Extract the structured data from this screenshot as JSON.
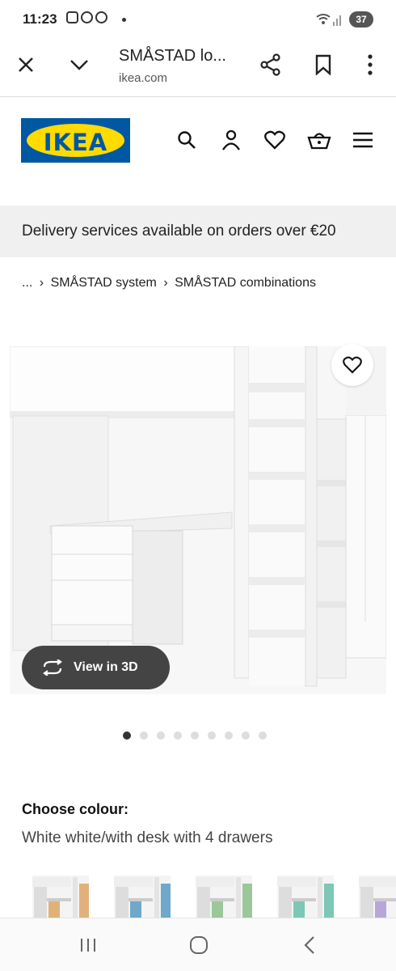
{
  "status_bar": {
    "time": "11:23",
    "battery": "37"
  },
  "browser": {
    "page_title": "SMÅSTAD lo...",
    "url": "ikea.com"
  },
  "header": {
    "logo_text": "IKEA"
  },
  "banner": {
    "text": "Delivery services available on orders over €20"
  },
  "breadcrumb": {
    "ellipsis": "...",
    "separator": "›",
    "items": [
      "SMÅSTAD system",
      "SMÅSTAD combinations"
    ]
  },
  "product": {
    "view3d_label": "View in 3D",
    "carousel_total": 9,
    "carousel_active": 1
  },
  "colour": {
    "heading": "Choose colour:",
    "selected": "White white/with desk with 4 drawers",
    "swatch_accents": [
      "#e0b27a",
      "#6fa8c9",
      "#9cc79a",
      "#7cc7b6",
      "#b8a6d9"
    ]
  },
  "colors": {
    "ikea_blue": "#0058a3",
    "ikea_yellow": "#ffdb00"
  }
}
